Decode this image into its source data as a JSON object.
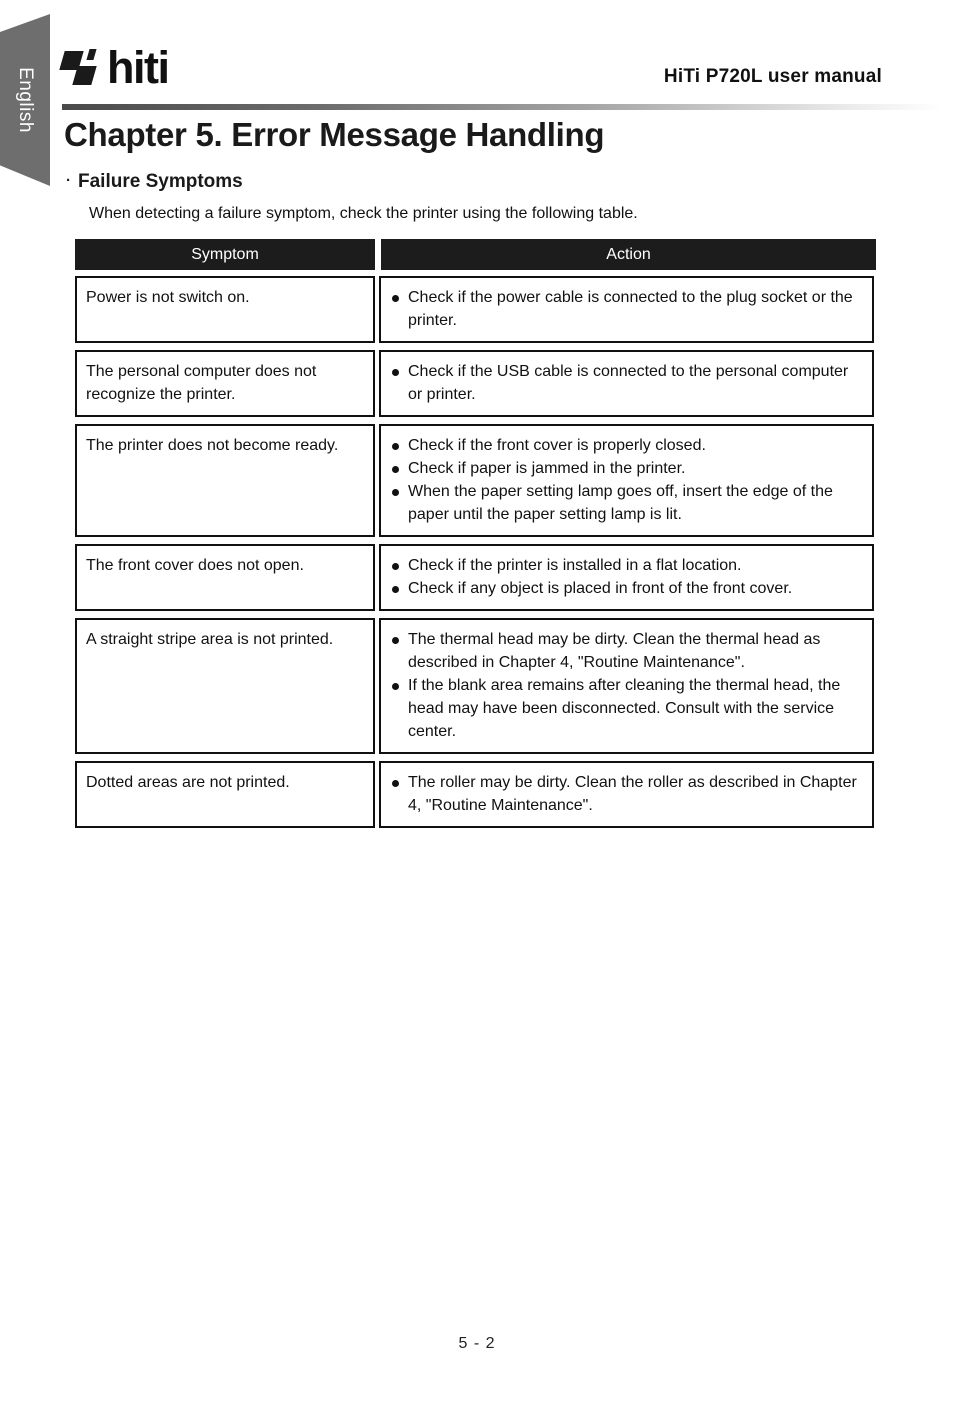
{
  "sidebar": {
    "language_tab": "English"
  },
  "header": {
    "logo_text": "hiti",
    "manual_title": "HiTi P720L user manual"
  },
  "page": {
    "chapter_title": "Chapter 5. Error Message Handling",
    "section_marker": "·",
    "section_title": "Failure Symptoms",
    "intro_text": "When detecting a failure symptom, check the printer using the following table.",
    "footer": "5 - 2"
  },
  "table": {
    "columns": [
      "Symptom",
      "Action"
    ],
    "rows": [
      {
        "symptom": "Power is not switch on.",
        "actions": [
          "Check if the power cable is connected to the plug socket or the printer."
        ]
      },
      {
        "symptom": "The personal computer does not recognize the printer.",
        "actions": [
          "Check if the USB cable is connected to the personal computer or printer."
        ]
      },
      {
        "symptom": "The printer does not become ready.",
        "actions": [
          "Check if the front cover is properly closed.",
          "Check if paper is jammed in the printer.",
          "When the paper setting lamp goes off, insert the edge of the paper until the paper setting lamp is lit."
        ]
      },
      {
        "symptom": "The front cover does not open.",
        "actions": [
          "Check if the printer is installed in a flat location.",
          "Check if any object is placed in front of the front cover."
        ]
      },
      {
        "symptom": "A straight stripe area is not printed.",
        "actions": [
          "The thermal head may be dirty. Clean the thermal head as described in Chapter 4, \"Routine Maintenance\".",
          "If the blank area remains after cleaning the thermal head, the head may have been disconnected. Consult with the service center."
        ]
      },
      {
        "symptom": "Dotted areas are not printed.",
        "actions": [
          "The roller may be dirty. Clean the roller as described in Chapter 4, \"Routine Maintenance\"."
        ]
      }
    ]
  }
}
